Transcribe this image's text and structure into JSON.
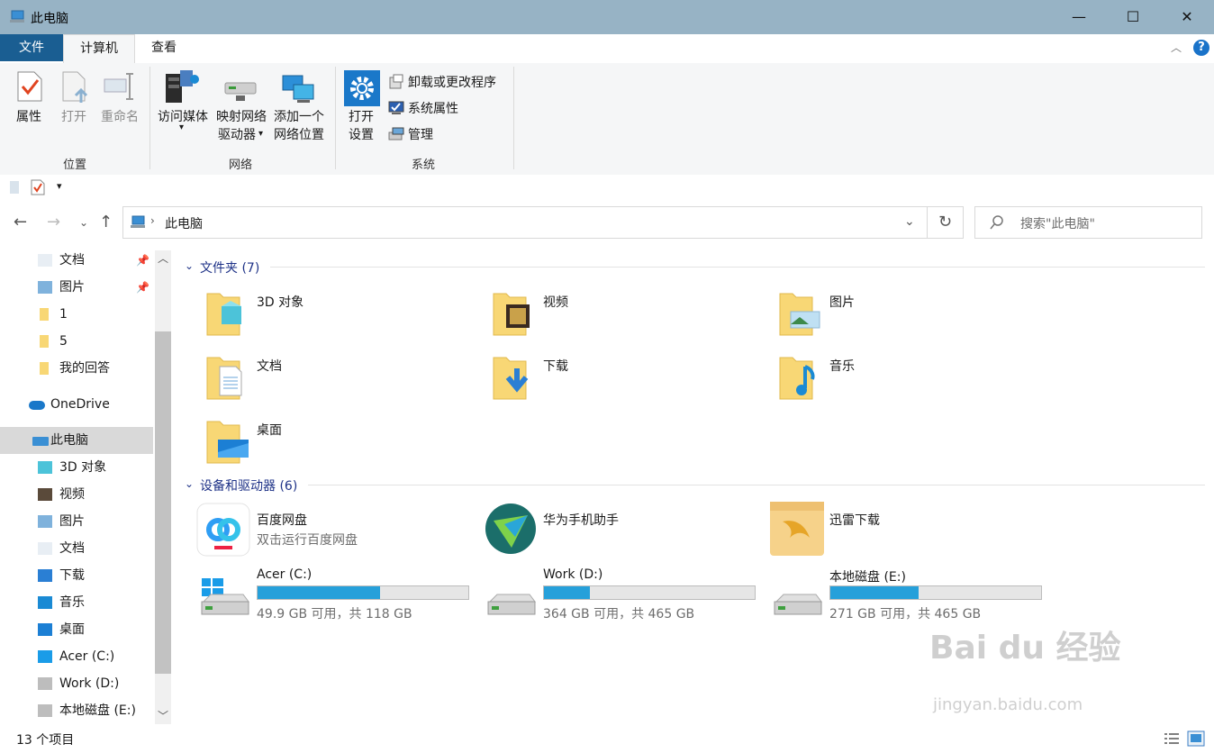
{
  "window": {
    "title": "此电脑",
    "minimize": "—",
    "maximize": "☐",
    "close": "✕"
  },
  "tabs": {
    "file": "文件",
    "computer": "计算机",
    "view": "查看"
  },
  "ribbon": {
    "location": {
      "label": "位置",
      "properties": "属性",
      "open": "打开",
      "rename": "重命名"
    },
    "network": {
      "label": "网络",
      "access_media": "访问媒体",
      "map_drive_1": "映射网络",
      "map_drive_2": "驱动器",
      "add_location_1": "添加一个",
      "add_location_2": "网络位置"
    },
    "system": {
      "label": "系统",
      "open_settings_1": "打开",
      "open_settings_2": "设置",
      "uninstall": "卸载或更改程序",
      "sys_props": "系统属性",
      "manage": "管理"
    }
  },
  "address": {
    "path": "此电脑",
    "search_placeholder": "搜索\"此电脑\""
  },
  "nav": {
    "items": [
      {
        "label": "文档",
        "icon": "document-icon",
        "pinned": true
      },
      {
        "label": "图片",
        "icon": "pictures-icon",
        "pinned": true
      },
      {
        "label": "1",
        "icon": "folder-icon"
      },
      {
        "label": "5",
        "icon": "folder-icon"
      },
      {
        "label": "我的回答",
        "icon": "folder-icon"
      },
      {
        "label": "OneDrive",
        "icon": "onedrive-icon"
      },
      {
        "label": "此电脑",
        "icon": "computer-icon"
      },
      {
        "label": "3D 对象",
        "icon": "3d-objects-icon"
      },
      {
        "label": "视频",
        "icon": "video-icon"
      },
      {
        "label": "图片",
        "icon": "pictures-icon"
      },
      {
        "label": "文档",
        "icon": "document-icon"
      },
      {
        "label": "下载",
        "icon": "download-icon"
      },
      {
        "label": "音乐",
        "icon": "music-icon"
      },
      {
        "label": "桌面",
        "icon": "desktop-icon"
      },
      {
        "label": "Acer (C:)",
        "icon": "windows-drive-icon"
      },
      {
        "label": "Work (D:)",
        "icon": "drive-icon"
      },
      {
        "label": "本地磁盘 (E:)",
        "icon": "drive-icon"
      }
    ]
  },
  "folders": {
    "header": "文件夹 (7)",
    "items": [
      {
        "label": "3D 对象",
        "icon": "3d-objects-folder-icon"
      },
      {
        "label": "视频",
        "icon": "video-folder-icon"
      },
      {
        "label": "图片",
        "icon": "pictures-folder-icon"
      },
      {
        "label": "文档",
        "icon": "documents-folder-icon"
      },
      {
        "label": "下载",
        "icon": "downloads-folder-icon"
      },
      {
        "label": "音乐",
        "icon": "music-folder-icon"
      },
      {
        "label": "桌面",
        "icon": "desktop-folder-icon"
      }
    ]
  },
  "devices": {
    "header": "设备和驱动器 (6)",
    "apps": [
      {
        "label": "百度网盘",
        "sub": "双击运行百度网盘",
        "icon": "baidu-netdisk-icon"
      },
      {
        "label": "华为手机助手",
        "icon": "huawei-hisuite-icon"
      },
      {
        "label": "迅雷下载",
        "icon": "xunlei-icon"
      }
    ],
    "drives": [
      {
        "label": "Acer (C:)",
        "free": "49.9 GB 可用，共 118 GB",
        "used_fraction": 0.58,
        "icon": "windows-drive-icon"
      },
      {
        "label": "Work (D:)",
        "free": "364 GB 可用，共 465 GB",
        "used_fraction": 0.22,
        "icon": "drive-icon"
      },
      {
        "label": "本地磁盘 (E:)",
        "free": "271 GB 可用，共 465 GB",
        "used_fraction": 0.42,
        "icon": "drive-icon"
      }
    ]
  },
  "status": {
    "count": "13 个项目"
  },
  "watermark": {
    "brand": "Bai du 经验",
    "url": "jingyan.baidu.com"
  },
  "colors": {
    "accent": "#26a0da",
    "file_tab": "#1a5e92",
    "titlebar": "#97b3c5",
    "folder": "#f8d775"
  }
}
